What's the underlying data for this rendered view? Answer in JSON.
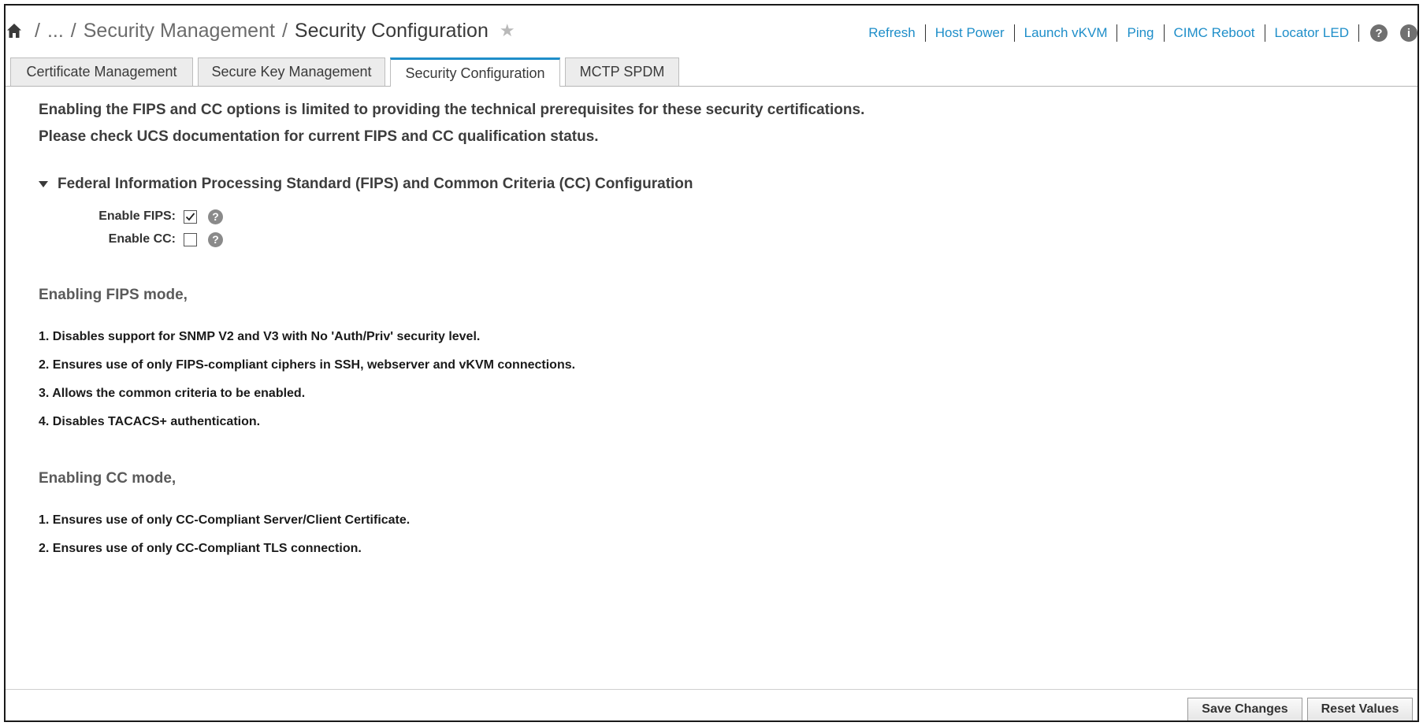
{
  "header": {
    "breadcrumb": {
      "ellipsis": "...",
      "separator": "/",
      "parent": "Security Management",
      "current": "Security Configuration"
    },
    "actions": [
      {
        "label": "Refresh"
      },
      {
        "label": "Host Power"
      },
      {
        "label": "Launch vKVM"
      },
      {
        "label": "Ping"
      },
      {
        "label": "CIMC Reboot"
      },
      {
        "label": "Locator LED"
      }
    ]
  },
  "tabs": [
    {
      "label": "Certificate Management",
      "active": false
    },
    {
      "label": "Secure Key Management",
      "active": false
    },
    {
      "label": "Security Configuration",
      "active": true
    },
    {
      "label": "MCTP SPDM",
      "active": false
    }
  ],
  "notice": {
    "line1": "Enabling the FIPS and CC options is limited to providing the technical prerequisites for these security certifications.",
    "line2": "Please check UCS documentation for current FIPS and CC qualification status."
  },
  "section": {
    "title": "Federal Information Processing Standard (FIPS) and Common Criteria (CC) Configuration",
    "fields": [
      {
        "label": "Enable FIPS:",
        "checked": true
      },
      {
        "label": "Enable CC:",
        "checked": false
      }
    ]
  },
  "fips_mode": {
    "heading": "Enabling FIPS mode,",
    "items": [
      "1. Disables support for SNMP V2 and V3 with No 'Auth/Priv' security level.",
      "2. Ensures use of only FIPS-compliant ciphers in SSH, webserver and vKVM connections.",
      "3. Allows the common criteria to be enabled.",
      "4. Disables TACACS+ authentication."
    ]
  },
  "cc_mode": {
    "heading": "Enabling CC mode,",
    "items": [
      "1. Ensures use of only CC-Compliant Server/Client Certificate.",
      "2. Ensures use of only CC-Compliant TLS connection."
    ]
  },
  "footer": {
    "save_label": "Save Changes",
    "reset_label": "Reset Values"
  },
  "colors": {
    "accent": "#1e8ec9",
    "tab_inactive": "#ececec",
    "help_icon": "#8a8a8a"
  },
  "icons": {
    "home": "home-icon",
    "favorite": "star-icon",
    "help": "help-icon",
    "info": "info-icon",
    "collapse": "caret-down-icon",
    "check": "check-icon"
  }
}
